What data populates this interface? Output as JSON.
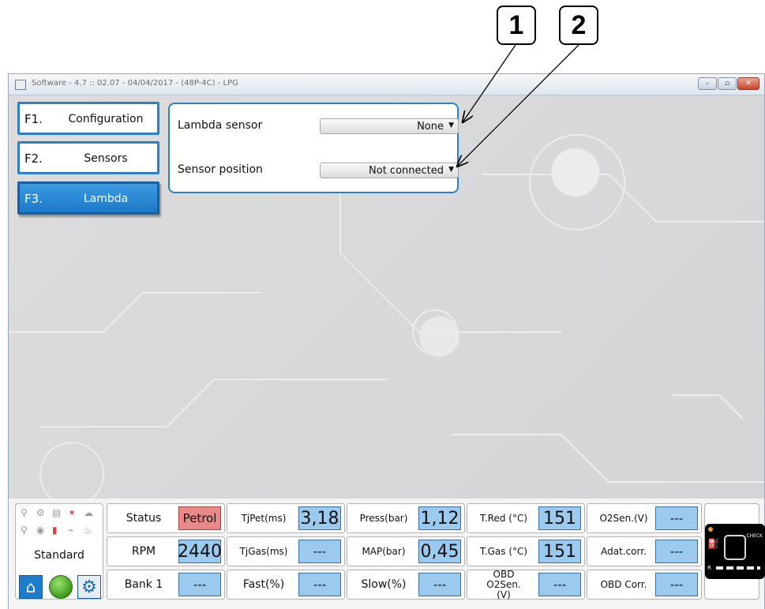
{
  "callouts": [
    "1",
    "2"
  ],
  "window": {
    "title": "Software - 4.7 :: 02.07 - 04/04/2017 - (48P-4C) - LPG",
    "controls": {
      "minimize": "–",
      "maximize": "▫",
      "close": "✕"
    }
  },
  "nav": [
    {
      "key": "F1.",
      "label": "Configuration",
      "active": false
    },
    {
      "key": "F2.",
      "label": "Sensors",
      "active": false
    },
    {
      "key": "F3.",
      "label": "Lambda",
      "active": true
    }
  ],
  "lambda_panel": {
    "lambda_sensor": {
      "label": "Lambda sensor",
      "value": "None"
    },
    "sensor_position": {
      "label": "Sensor position",
      "value": "Not connected"
    }
  },
  "status_bar": {
    "mode": "Standard",
    "mini_icons": [
      "injector-icon",
      "filter-icon",
      "printer-icon",
      "fuel-cell-icon",
      "cloud-icon",
      "map-pin-icon",
      "sensor-icon",
      "extinguisher-icon",
      "graph-icon",
      "temperature-icon"
    ],
    "cells": [
      {
        "label": "Status",
        "value": "Petrol",
        "style": "red"
      },
      {
        "label": "RPM",
        "value": "2440",
        "style": "big"
      },
      {
        "label": "Bank 1",
        "value": "---",
        "style": "normal"
      },
      {
        "label": "TjPet(ms)",
        "value": "3,18",
        "style": "big"
      },
      {
        "label": "TjGas(ms)",
        "value": "---",
        "style": "normal"
      },
      {
        "label": "Fast(%)",
        "value": "---",
        "style": "normal"
      },
      {
        "label": "Press(bar)",
        "value": "1,12",
        "style": "big"
      },
      {
        "label": "MAP(bar)",
        "value": "0,45",
        "style": "big"
      },
      {
        "label": "Slow(%)",
        "value": "---",
        "style": "normal"
      },
      {
        "label": "T.Red (°C)",
        "value": "151",
        "style": "big"
      },
      {
        "label": "T.Gas (°C)",
        "value": "151",
        "style": "big"
      },
      {
        "label": "OBD O2Sen.(V)",
        "value": "---",
        "style": "normal"
      },
      {
        "label": "O2Sen.(V)",
        "value": "---",
        "style": "normal"
      },
      {
        "label": "Adat.corr.",
        "value": "---",
        "style": "normal"
      },
      {
        "label": "OBD Corr.",
        "value": "---",
        "style": "normal"
      }
    ],
    "ecu": {
      "check_label": "CHECK",
      "r_label": "R"
    }
  },
  "colors": {
    "accent": "#2f7fc4",
    "value_bg": "#9cc9ee",
    "petrol_bg": "#e88a8a"
  }
}
